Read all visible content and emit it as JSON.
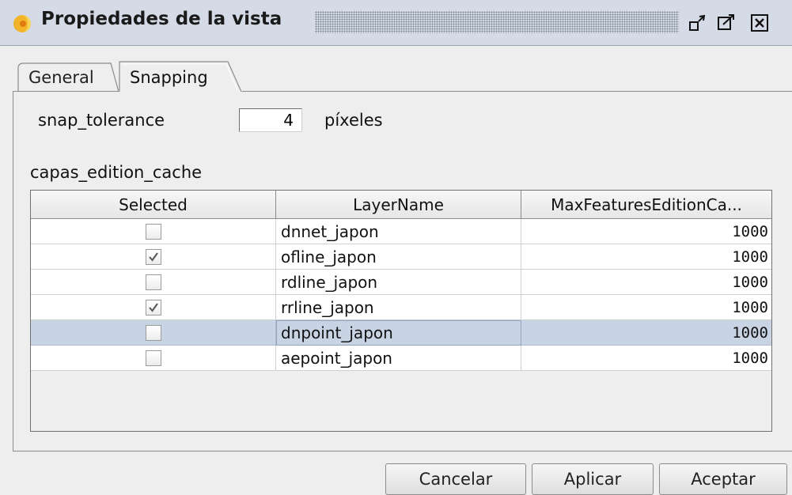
{
  "window": {
    "title": "Propiedades de la vista",
    "icon": "gvsig-logo-icon",
    "controls": [
      "restore-icon",
      "maximize-icon",
      "close-icon"
    ]
  },
  "tabs": [
    {
      "label": "General",
      "active": false
    },
    {
      "label": "Snapping",
      "active": true
    }
  ],
  "snapping": {
    "tolerance_label": "snap_tolerance",
    "tolerance_value": "4",
    "tolerance_unit": "píxeles",
    "cache_label": "capas_edition_cache"
  },
  "table": {
    "columns": [
      "Selected",
      "LayerName",
      "MaxFeaturesEditionCa..."
    ],
    "rows": [
      {
        "selected": false,
        "name": "dnnet_japon",
        "max": "1000"
      },
      {
        "selected": true,
        "name": "ofline_japon",
        "max": "1000"
      },
      {
        "selected": false,
        "name": "rdline_japon",
        "max": "1000"
      },
      {
        "selected": true,
        "name": "rrline_japon",
        "max": "1000"
      },
      {
        "selected": false,
        "name": "dnpoint_japon",
        "max": "1000",
        "highlighted": true
      },
      {
        "selected": false,
        "name": "aepoint_japon",
        "max": "1000"
      }
    ]
  },
  "buttons": {
    "cancel": "Cancelar",
    "apply": "Aplicar",
    "accept": "Aceptar"
  },
  "colors": {
    "titlebar": "#d4dbe6",
    "selected_row": "#c8d4e4",
    "background": "#eeeeee"
  }
}
